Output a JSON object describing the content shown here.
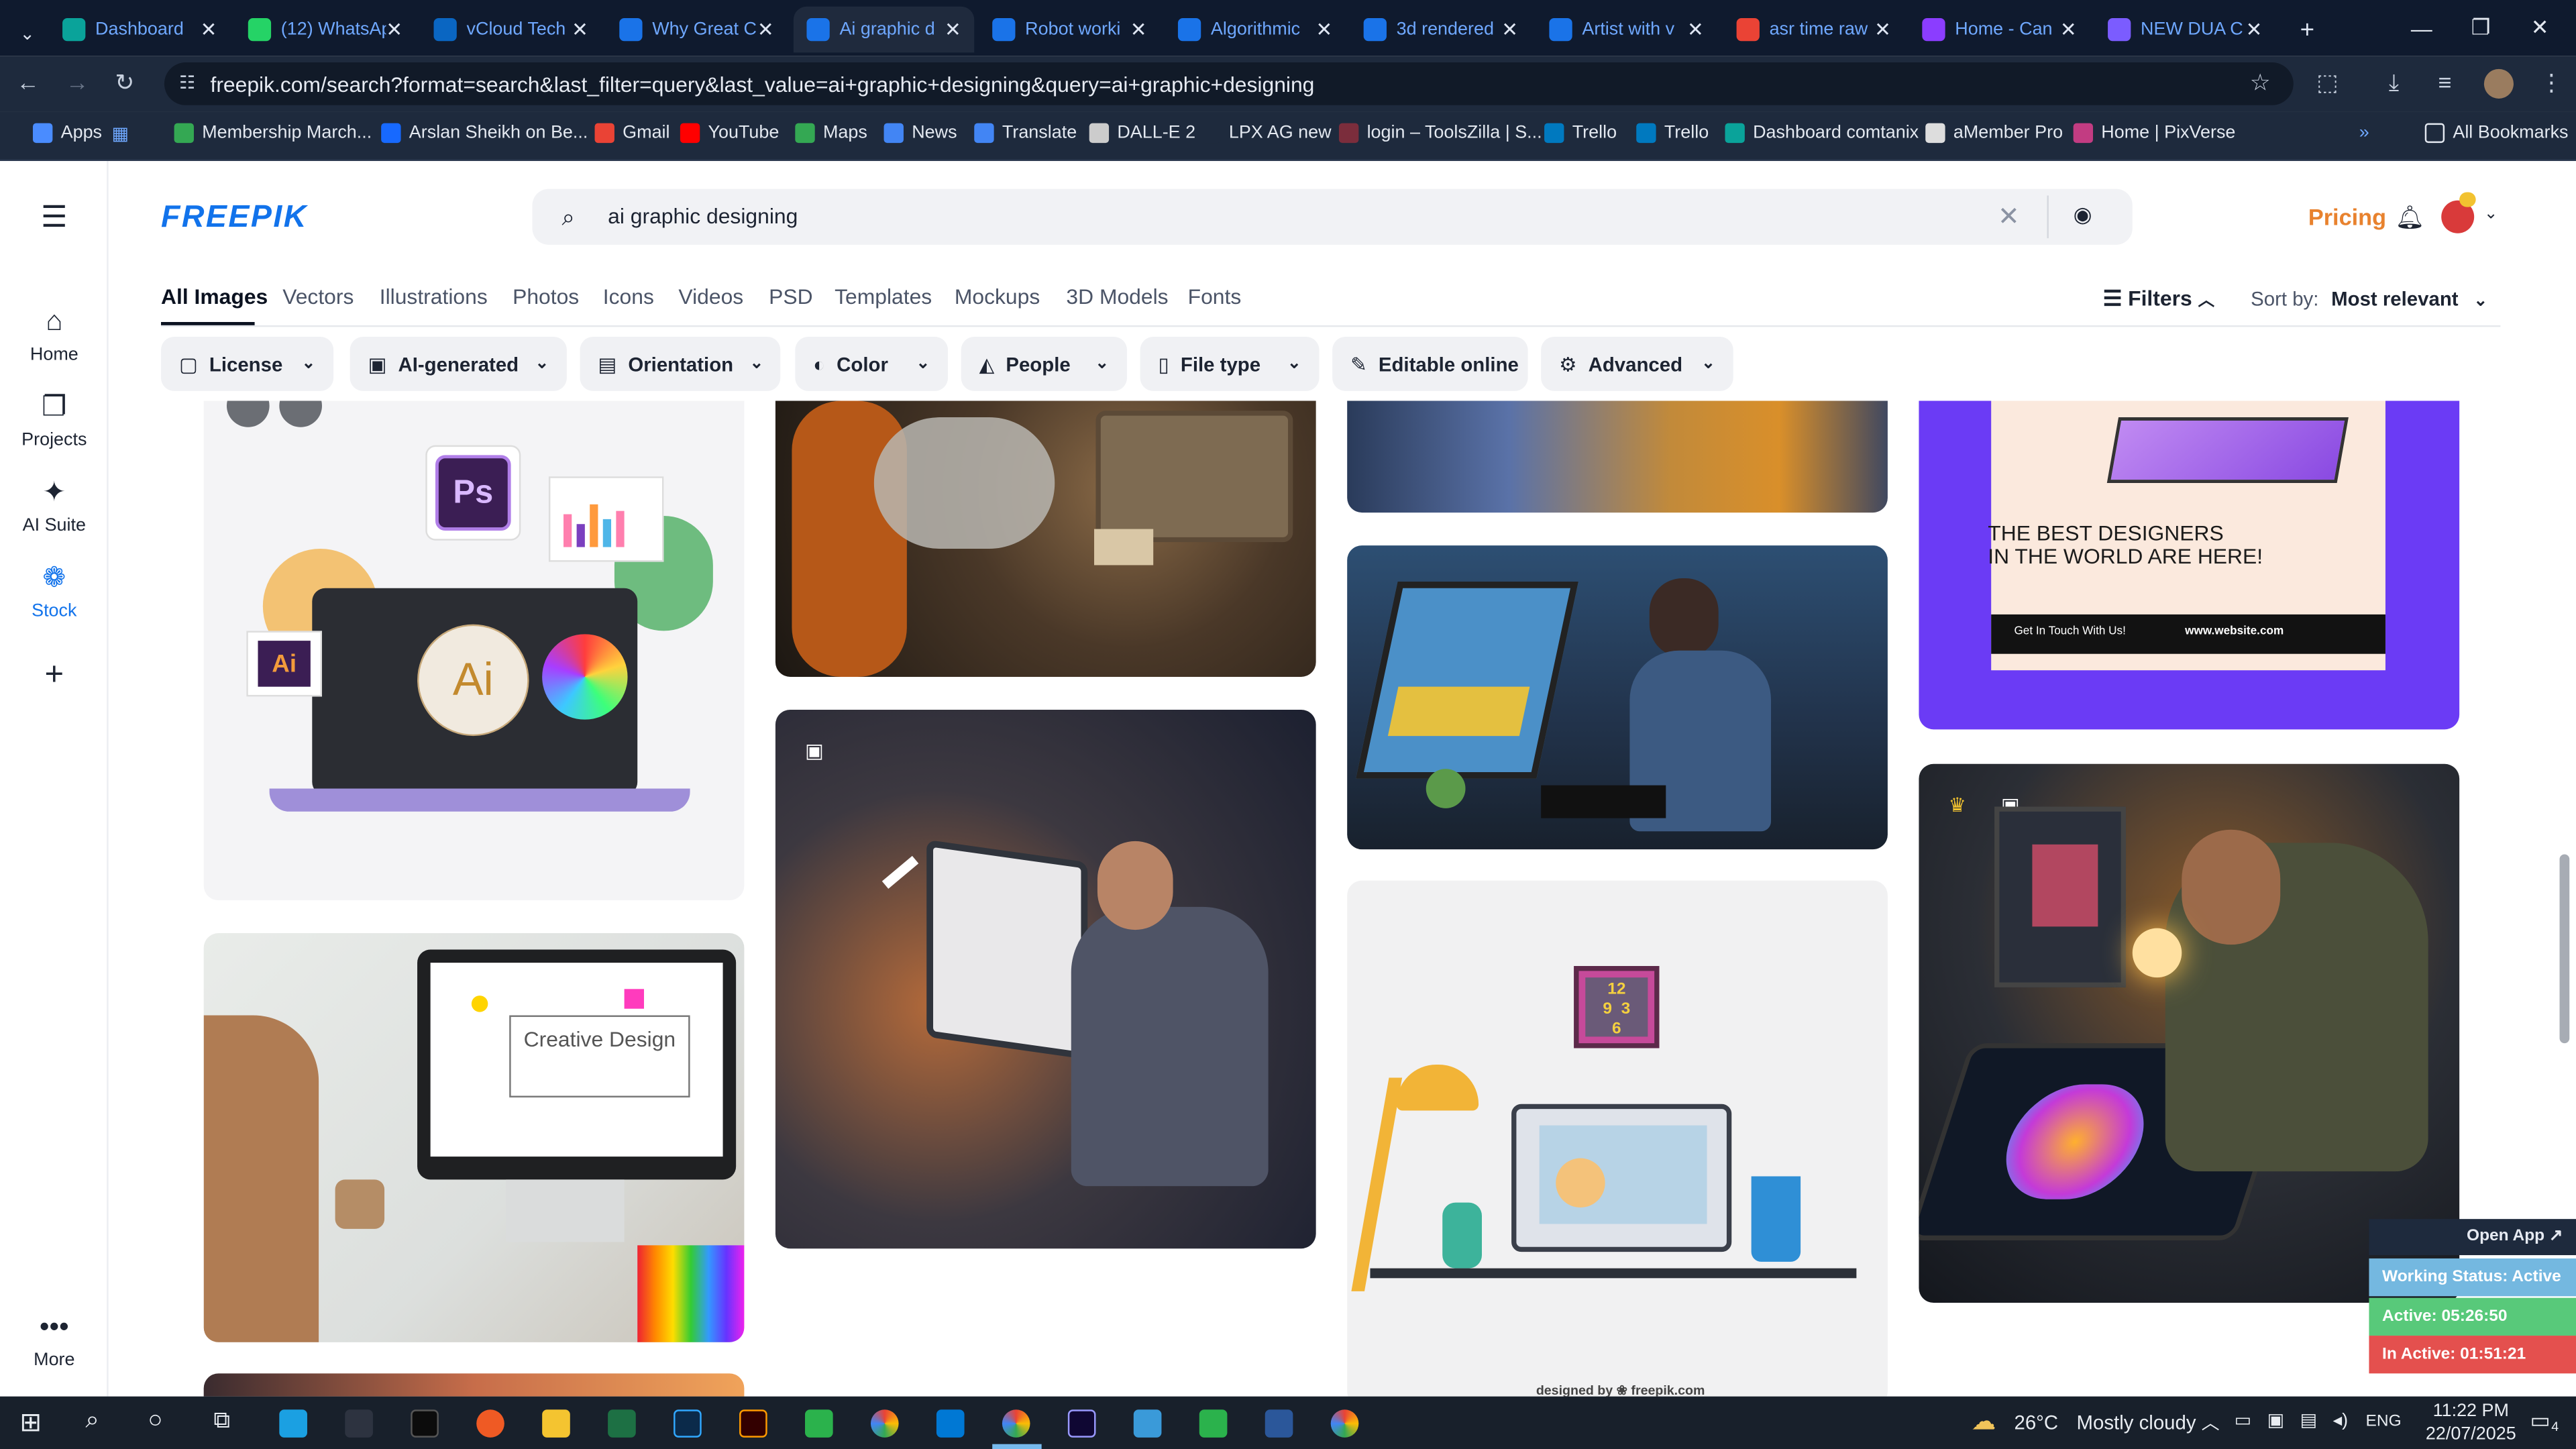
{
  "browser": {
    "tabs": [
      {
        "title": "Dashboard",
        "color": "#0aa39a"
      },
      {
        "title": "(12) WhatsAp",
        "color": "#25d366"
      },
      {
        "title": "vCloud Tech",
        "color": "#0a66c2"
      },
      {
        "title": "Why Great C",
        "color": "#1a73e8"
      },
      {
        "title": "Ai graphic d",
        "color": "#1a73e8"
      },
      {
        "title": "Robot worki",
        "color": "#1a73e8"
      },
      {
        "title": "Algorithmic",
        "color": "#1a73e8"
      },
      {
        "title": "3d rendered",
        "color": "#1a73e8"
      },
      {
        "title": "Artist with v",
        "color": "#1a73e8"
      },
      {
        "title": "asr time raw",
        "color": "#ea4335"
      },
      {
        "title": "Home - Can",
        "color": "#8b3dff"
      },
      {
        "title": "NEW DUA C",
        "color": "#7b5cff"
      }
    ],
    "new_tab": "+",
    "url": "freepik.com/search?format=search&last_filter=query&last_value=ai+graphic+designing&query=ai+graphic+designing",
    "bookmarks": [
      {
        "label": "Apps",
        "color": "#4a8cff"
      },
      {
        "label": "Membership March...",
        "color": "#34a853"
      },
      {
        "label": "Arslan Sheikh on Be...",
        "color": "#1769ff"
      },
      {
        "label": "Gmail",
        "color": "#ea4335"
      },
      {
        "label": "YouTube",
        "color": "#ff0000"
      },
      {
        "label": "Maps",
        "color": "#34a853"
      },
      {
        "label": "News",
        "color": "#4285f4"
      },
      {
        "label": "Translate",
        "color": "#4285f4"
      },
      {
        "label": "DALL-E 2",
        "color": "#cccccc"
      },
      {
        "label": "LPX AG new",
        "color": "#1e2a3d"
      },
      {
        "label": "login – ToolsZilla | S...",
        "color": "#7b2d3c"
      },
      {
        "label": "Trello",
        "color": "#0079bf"
      },
      {
        "label": "Trello",
        "color": "#0079bf"
      },
      {
        "label": "Dashboard comtanix",
        "color": "#0aa39a"
      },
      {
        "label": "aMember Pro",
        "color": "#dddddd"
      },
      {
        "label": "Home | PixVerse",
        "color": "#c23c82"
      }
    ],
    "more_bookmarks": "»",
    "all_bookmarks": "All Bookmarks"
  },
  "sidebar": {
    "items": [
      {
        "label": "Home",
        "icon": "home-icon",
        "glyph": "⌂"
      },
      {
        "label": "Projects",
        "icon": "projects-icon",
        "glyph": "❐"
      },
      {
        "label": "AI Suite",
        "icon": "ai-suite-icon",
        "glyph": "✦"
      },
      {
        "label": "Stock",
        "icon": "stock-icon",
        "glyph": "❁"
      }
    ],
    "add": "+",
    "more_label": "More",
    "more_glyph": "•••"
  },
  "header": {
    "logo": "FREEPIK",
    "search_value": "ai graphic designing",
    "pricing": "Pricing"
  },
  "type_tabs": [
    "All Images",
    "Vectors",
    "Illustrations",
    "Photos",
    "Icons",
    "Videos",
    "PSD",
    "Templates",
    "Mockups",
    "3D Models",
    "Fonts"
  ],
  "filters_label": "Filters",
  "sort_label": "Sort by:",
  "sort_value": "Most relevant",
  "chips": [
    {
      "label": "License",
      "icon": "▢"
    },
    {
      "label": "AI-generated",
      "icon": "▣"
    },
    {
      "label": "Orientation",
      "icon": "▤"
    },
    {
      "label": "Color",
      "icon": "◐"
    },
    {
      "label": "People",
      "icon": "◭"
    },
    {
      "label": "File type",
      "icon": "▯"
    },
    {
      "label": "Editable online",
      "icon": "✎"
    },
    {
      "label": "Advanced",
      "icon": "⚙"
    }
  ],
  "images": {
    "ps": "Ps",
    "ai": "Ai",
    "creative_design": "Creative Design",
    "best_designers_1": "THE BEST DESIGNERS",
    "best_designers_2": "IN THE WORLD ARE HERE!",
    "get_in_touch": "Get In Touch With Us!",
    "website": "www.website.com",
    "designed_by": "designed by ❀ freepik.com"
  },
  "status_widget": {
    "open_app": "Open App ↗",
    "working": "Working Status: Active",
    "active": "Active: 05:26:50",
    "inactive": "In Active: 01:51:21"
  },
  "taskbar": {
    "weather_temp": "26°C",
    "weather_desc": "Mostly cloudy",
    "lang": "ENG",
    "time": "11:22 PM",
    "date": "22/07/2025",
    "notif": "4"
  }
}
